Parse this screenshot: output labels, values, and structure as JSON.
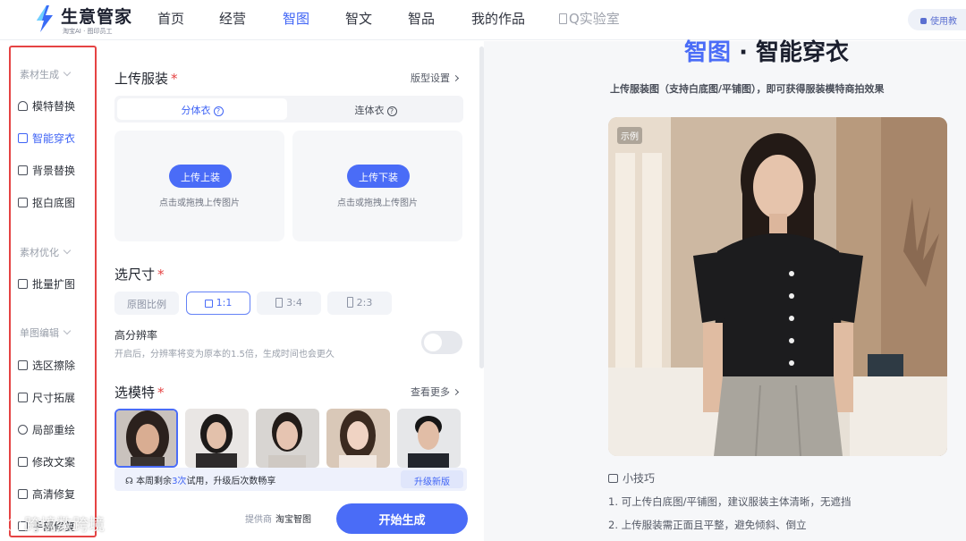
{
  "brand": {
    "title": "生意管家",
    "subtitle": "淘宝AI · 图印员工",
    "accent": "#4a6cf7"
  },
  "nav": {
    "items": [
      "首页",
      "经营",
      "智图",
      "智文",
      "智品",
      "我的作品"
    ],
    "active": "智图",
    "lab": "Q实验室",
    "help": "使用教"
  },
  "sidebar": {
    "groups": [
      {
        "label": "素材生成",
        "items": [
          "模特替换",
          "智能穿衣",
          "背景替换",
          "抠白底图"
        ]
      },
      {
        "label": "素材优化",
        "items": [
          "批量扩图"
        ]
      },
      {
        "label": "单图编辑",
        "items": [
          "选区擦除",
          "尺寸拓展",
          "局部重绘",
          "修改文案",
          "高清修复",
          "手部修复"
        ]
      }
    ],
    "active": "智能穿衣",
    "active_color": "#3e63f5",
    "highlight_color": "#e54343"
  },
  "upload": {
    "title": "上传服装",
    "settings_link": "版型设置",
    "tabs": [
      "分体衣",
      "连体衣"
    ],
    "active_tab": "分体衣",
    "top_button": "上传上装",
    "bottom_button": "上传下装",
    "hint": "点击或拖拽上传图片"
  },
  "size": {
    "title": "选尺寸",
    "options": [
      "原图比例",
      "1:1",
      "3:4",
      "2:3"
    ],
    "selected": "1:1"
  },
  "hires": {
    "title": "高分辨率",
    "desc": "开启后，分辨率将变为原本的1.5倍，生成时间也会更久",
    "enabled": false
  },
  "models": {
    "title": "选模特",
    "more": "查看更多",
    "count_shown": 5,
    "selected_index": 0
  },
  "promo": {
    "text_before": "本周剩余",
    "count": "3次",
    "text_after": "试用，升级后次数畅享",
    "button": "升级新版"
  },
  "footer": {
    "provider_label": "提供商",
    "provider": "淘宝智图",
    "start": "开始生成"
  },
  "preview": {
    "title_blue": "智图",
    "title_rest": " · 智能穿衣",
    "subtitle": "上传服装图（支持白底图/平铺图），即可获得服装模特商拍效果",
    "tag": "示例",
    "tips_title": "小技巧",
    "tips": [
      "1. 可上传白底图/平铺图，建议服装主体清晰，无遮挡",
      "2. 上传服装需正面且平整，避免倾斜、倒立"
    ]
  },
  "watermark": "跨境数跨境"
}
